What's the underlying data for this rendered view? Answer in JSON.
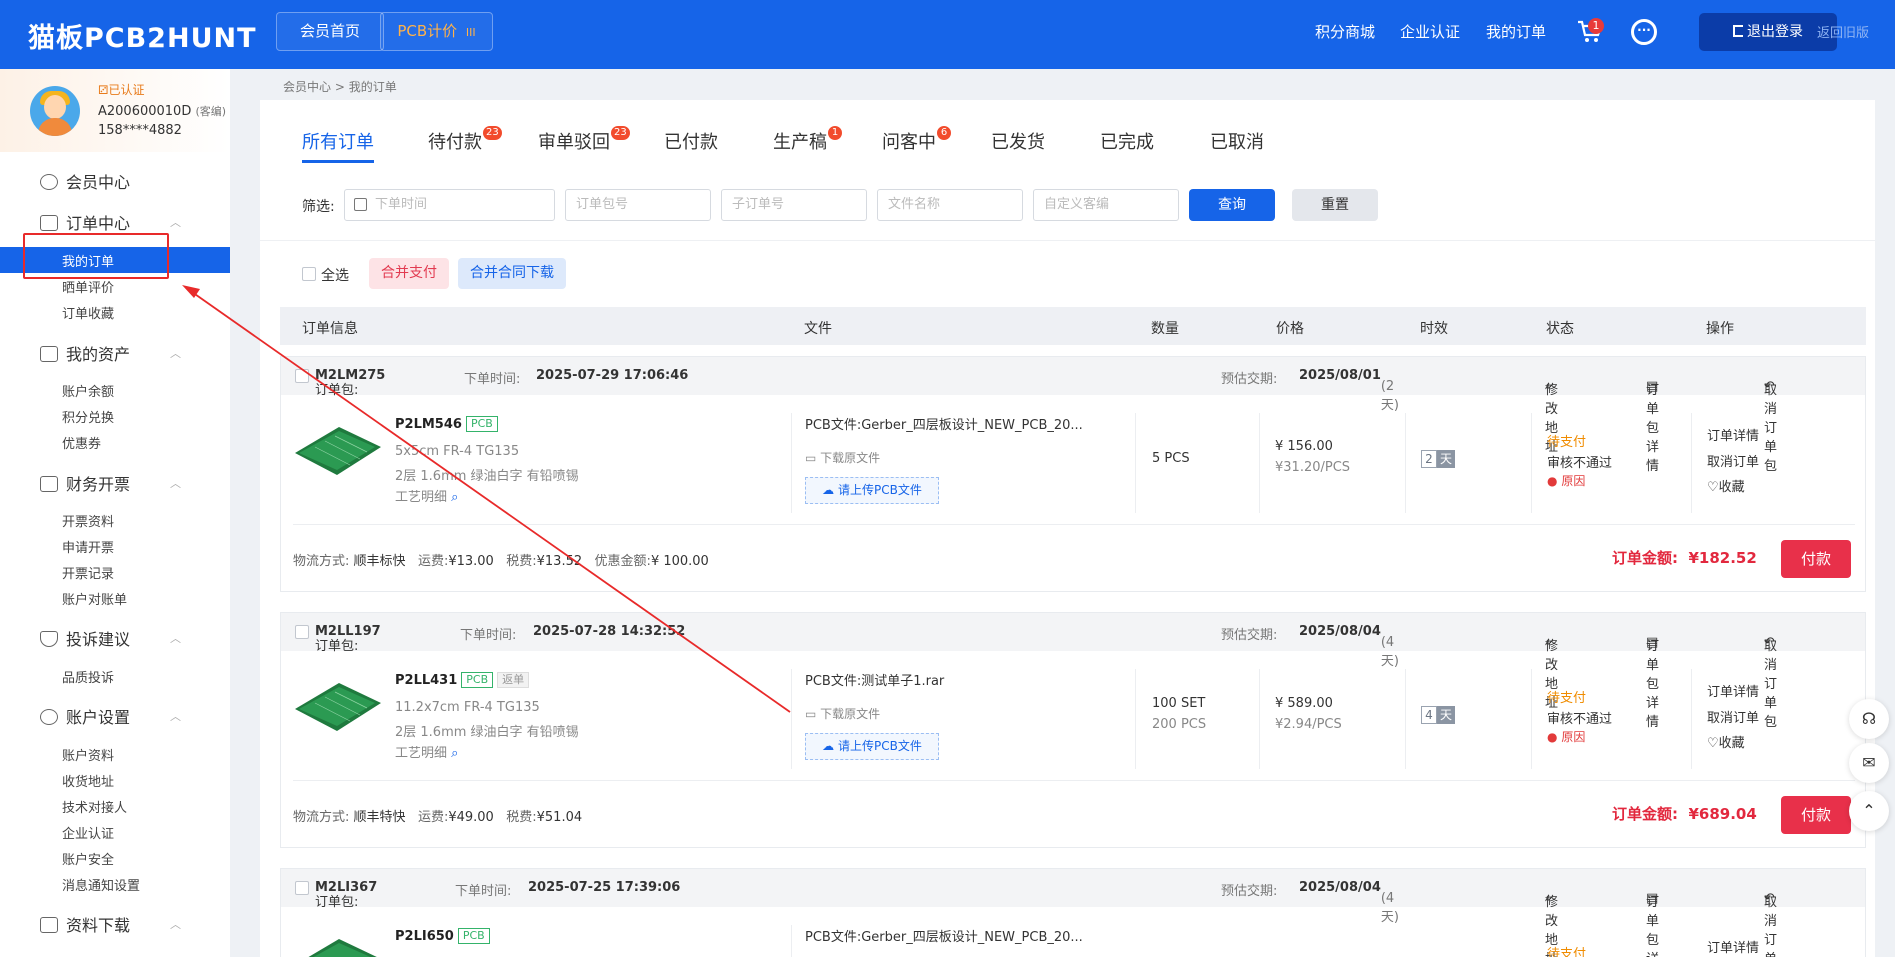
{
  "header": {
    "logo": "猫板PCB2HUNT",
    "member_home": "会员首页",
    "pcb_quote": "PCB计价",
    "pcb_quote_icon": "III",
    "nav": [
      "积分商城",
      "企业认证",
      "我的订单"
    ],
    "cart_count": "1",
    "logout": "退出登录",
    "old_version": "返回旧版"
  },
  "user": {
    "verified": "已认证",
    "id": "A200600010D",
    "service": "(客编)",
    "phone": "158****4882"
  },
  "sidebar": {
    "member_center": "会员中心",
    "order_center": "订单中心",
    "order_items": [
      "我的订单",
      "晒单评价",
      "订单收藏"
    ],
    "assets": "我的资产",
    "asset_items": [
      "账户余额",
      "积分兑换",
      "优惠券"
    ],
    "finance": "财务开票",
    "finance_items": [
      "开票资料",
      "申请开票",
      "开票记录",
      "账户对账单"
    ],
    "complaint": "投诉建议",
    "complaint_items": [
      "品质投诉"
    ],
    "account": "账户设置",
    "account_items": [
      "账户资料",
      "收货地址",
      "技术对接人",
      "企业认证",
      "账户安全",
      "消息通知设置"
    ],
    "downloads": "资料下载"
  },
  "breadcrumb": {
    "a": "会员中心",
    "sep": ">",
    "b": "我的订单"
  },
  "tabs": [
    {
      "label": "所有订单",
      "badge": ""
    },
    {
      "label": "待付款",
      "badge": "23"
    },
    {
      "label": "审单驳回",
      "badge": "23"
    },
    {
      "label": "已付款",
      "badge": ""
    },
    {
      "label": "生产稿",
      "badge": "1"
    },
    {
      "label": "问客中",
      "badge": "6"
    },
    {
      "label": "已发货",
      "badge": ""
    },
    {
      "label": "已完成",
      "badge": ""
    },
    {
      "label": "已取消",
      "badge": ""
    }
  ],
  "filter": {
    "label": "筛选:",
    "placeholders": [
      "下单时间",
      "订单包号",
      "子订单号",
      "文件名称",
      "自定义客编"
    ],
    "query": "查询",
    "reset": "重置"
  },
  "actions": {
    "select_all": "全选",
    "merge_pay": "合并支付",
    "contract_download": "合并合同下载"
  },
  "table_head": [
    "订单信息",
    "文件",
    "数量",
    "价格",
    "时效",
    "状态",
    "操作"
  ],
  "card_labels": {
    "pkg": "订单包:",
    "order_time": "下单时间:",
    "est_delivery": "预估交期:",
    "modify_address": "修改地址",
    "pkg_detail": "订单包详情",
    "cancel_pkg": "取消订单包",
    "pcb_file": "PCB文件:",
    "download_src": "下载原文件",
    "upload": "请上传PCB文件",
    "craft": "工艺明细",
    "days_unit": "天",
    "logistics": "物流方式:",
    "freight": "运费:",
    "tax": "税费:",
    "discount": "优惠金额:",
    "order_amount": "订单金额:",
    "pay": "付款",
    "op_detail": "订单详情",
    "op_cancel": "取消订单",
    "op_fav": "收藏",
    "reason": "原因",
    "pcb_tag": "PCB",
    "return_tag": "返单"
  },
  "orders": [
    {
      "pkg": "M2LM275",
      "time": "2025-07-29 17:06:46",
      "delivery": "2025/08/01",
      "delivery_days": "(2天)",
      "part": "P2LM546",
      "spec1": "5x5cm FR-4 TG135",
      "spec2": "2层 1.6mm 绿油白字 有铅喷锡",
      "file": "Gerber_四层板设计_NEW_PCB_20...",
      "qty": "5 PCS",
      "qty2": "",
      "price": "¥ 156.00",
      "unit": "¥31.20/PCS",
      "days": "2",
      "status": "待支付",
      "review": "审核不通过",
      "ship": "顺丰标快",
      "freight": "¥13.00",
      "tax": "¥13.52",
      "discount": "¥ 100.00",
      "total": "¥182.52"
    },
    {
      "pkg": "M2LL197",
      "time": "2025-07-28 14:32:52",
      "delivery": "2025/08/04",
      "delivery_days": "(4天)",
      "part": "P2LL431",
      "spec1": "11.2x7cm FR-4 TG135",
      "spec2": "2层 1.6mm 绿油白字 有铅喷锡",
      "file": "测试单子1.rar",
      "qty": "100 SET",
      "qty2": "200 PCS",
      "price": "¥ 589.00",
      "unit": "¥2.94/PCS",
      "days": "4",
      "status": "待支付",
      "review": "审核不通过",
      "ship": "顺丰特快",
      "freight": "¥49.00",
      "tax": "¥51.04",
      "total": "¥689.04"
    },
    {
      "pkg": "M2LI367",
      "time": "2025-07-25 17:39:06",
      "delivery": "2025/08/04",
      "delivery_days": "(4天)",
      "part": "P2LI650",
      "file": "Gerber_四层板设计_NEW_PCB_20...",
      "status": "待支付",
      "op": "订单详情"
    }
  ],
  "colors": {
    "primary": "#1664e8",
    "pay": "#e8304a",
    "pending": "#f08c00",
    "annotation": "#e82a2a"
  },
  "icons": [
    "cart-icon",
    "chat-icon",
    "logout-icon",
    "location-icon",
    "doc-icon",
    "undo-icon",
    "folder-icon",
    "cloud-upload-icon",
    "heart-icon",
    "alert-icon",
    "headset-icon",
    "message-icon",
    "top-icon"
  ]
}
